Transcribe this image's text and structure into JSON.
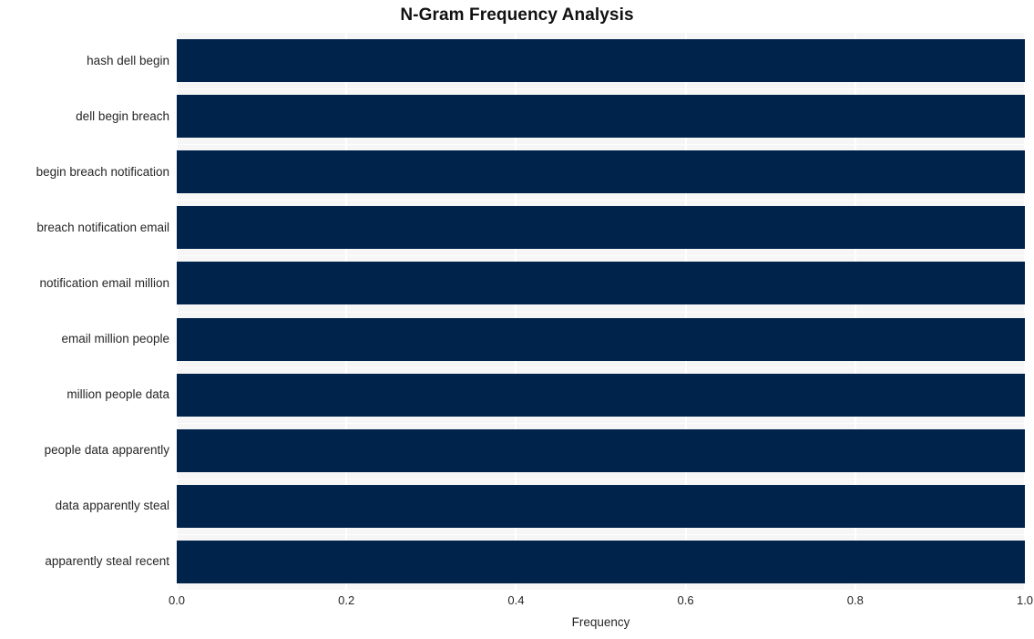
{
  "chart_data": {
    "type": "bar",
    "orientation": "horizontal",
    "title": "N-Gram Frequency Analysis",
    "xlabel": "Frequency",
    "ylabel": "",
    "categories": [
      "hash dell begin",
      "dell begin breach",
      "begin breach notification",
      "breach notification email",
      "notification email million",
      "email million people",
      "million people data",
      "people data apparently",
      "data apparently steal",
      "apparently steal recent"
    ],
    "values": [
      1.0,
      1.0,
      1.0,
      1.0,
      1.0,
      1.0,
      1.0,
      1.0,
      1.0,
      1.0
    ],
    "xlim": [
      0.0,
      1.0
    ],
    "xticks": [
      0.0,
      0.2,
      0.4,
      0.6,
      0.8,
      1.0
    ],
    "xtick_labels": [
      "0.0",
      "0.2",
      "0.4",
      "0.6",
      "0.8",
      "1.0"
    ],
    "grid": true,
    "legend": null,
    "bar_color": "#00234c",
    "plot_background": "#f6f6f6",
    "grid_color": "#ffffff",
    "text_color": "#262626",
    "title_color": "#111111"
  }
}
